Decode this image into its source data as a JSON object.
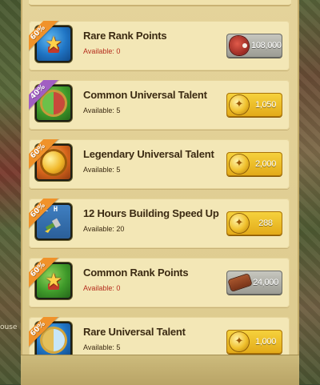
{
  "background": {
    "left_tag": "ouse"
  },
  "colors": {
    "panel": "#e4d39a",
    "row": "#f3e7b6",
    "gold_button": "#e9b920",
    "gray_button": "#a9a9a1",
    "discount_orange": "#f0922a",
    "discount_purple": "#a15fc2",
    "unavailable_red": "#b52d1e"
  },
  "items": [
    {
      "discount": "60%",
      "name": "Rare Rank Points",
      "available": "Available: 0",
      "icon": "rare-rank-points-icon",
      "currency": "meat-icon",
      "price": "108,000"
    },
    {
      "discount": "40%",
      "name": "Common Universal Talent",
      "available": "Available: 5",
      "icon": "common-universal-talent-icon",
      "currency": "gold-coin-icon",
      "price": "1,050"
    },
    {
      "discount": "60%",
      "name": "Legendary Universal Talent",
      "available": "Available: 5",
      "icon": "legendary-universal-talent-icon",
      "currency": "gold-coin-icon",
      "price": "2,000"
    },
    {
      "discount": "60%",
      "name": "12 Hours Building Speed Up",
      "available": "Available: 20",
      "icon": "building-speed-up-icon",
      "icon_label": "12 H",
      "currency": "gold-coin-icon",
      "price": "288"
    },
    {
      "discount": "60%",
      "name": "Common Rank Points",
      "available": "Available: 0",
      "icon": "common-rank-points-icon",
      "currency": "wood-icon",
      "price": "24,000"
    },
    {
      "discount": "60%",
      "name": "Rare Universal Talent",
      "available": "Available: 5",
      "icon": "rare-universal-talent-icon",
      "currency": "gold-coin-icon",
      "price": "1,000"
    }
  ]
}
